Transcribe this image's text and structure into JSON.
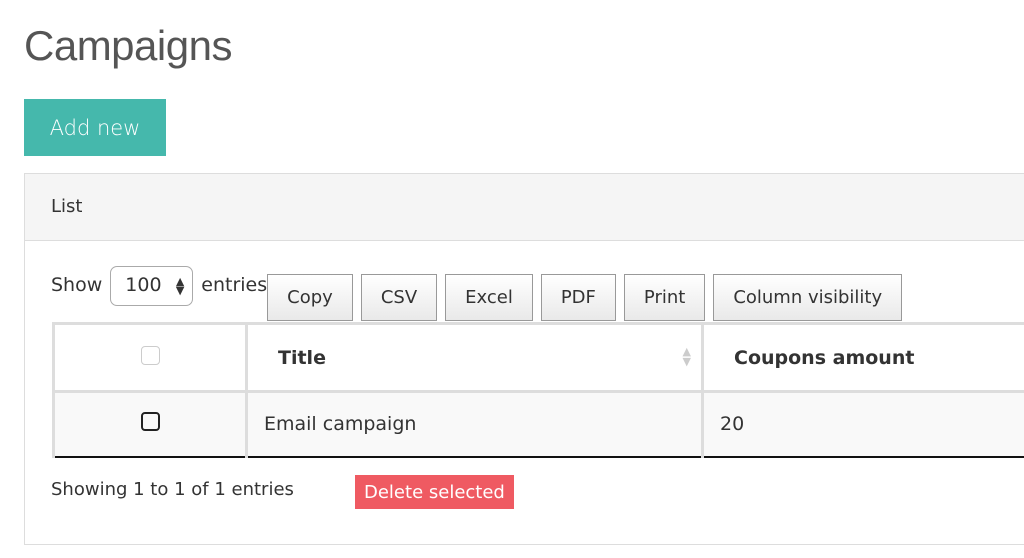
{
  "page": {
    "title": "Campaigns",
    "add_new": "Add new"
  },
  "card": {
    "header": "List"
  },
  "controls": {
    "show": "Show",
    "entries_value": "100",
    "entries": "entries",
    "buttons": [
      "Copy",
      "CSV",
      "Excel",
      "PDF",
      "Print",
      "Column visibility"
    ]
  },
  "table": {
    "columns": [
      "",
      "Title",
      "Coupons amount"
    ],
    "rows": [
      {
        "title": "Email campaign",
        "coupons_amount": "20",
        "checked": false
      }
    ]
  },
  "footer": {
    "info": "Showing 1 to 1 of 1 entries",
    "delete_selected": "Delete selected"
  },
  "colors": {
    "primary": "#45b8ac",
    "danger": "#ef5a62"
  }
}
